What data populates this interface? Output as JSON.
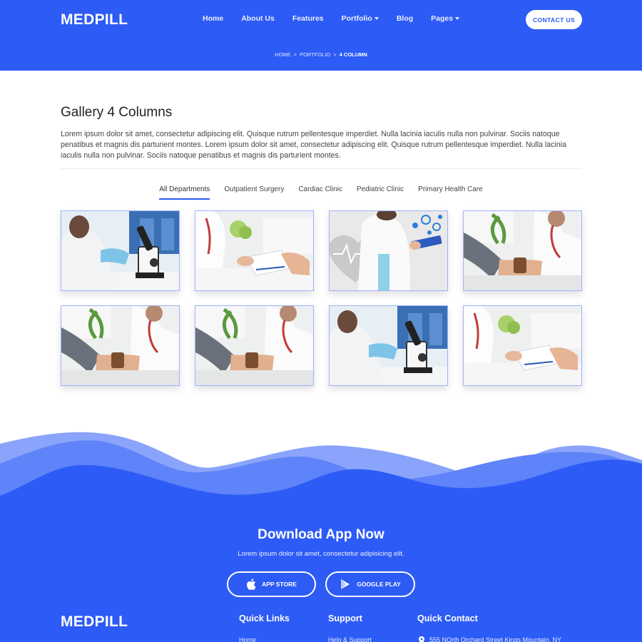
{
  "header": {
    "logo": "MEDPILL",
    "nav": [
      {
        "label": "Home"
      },
      {
        "label": "About Us"
      },
      {
        "label": "Features"
      },
      {
        "label": "Portfolio",
        "dropdown": true
      },
      {
        "label": "Blog"
      },
      {
        "label": "Pages",
        "dropdown": true
      }
    ],
    "contact_label": "CONTACT US",
    "breadcrumb": [
      "HOME",
      "PORTFOLIO",
      "4 COLUMN"
    ],
    "breadcrumb_separator": ">"
  },
  "main": {
    "title": "Gallery 4 Columns",
    "intro": "Lorem ipsum dolor sit amet, consectetur adipiscing elit. Quisque rutrum pellentesque imperdiet. Nulla lacinia iaculis nulla non pulvinar. Sociis natoque penatibus et magnis dis parturient montes. Lorem ipsum dolor sit amet, consectetur adipiscing elit. Quisque rutrum pellentesque imperdiet. Nulla lacinia iaculis nulla non pulvinar. Sociis natoque penatibus et magnis dis parturient montes.",
    "tabs": [
      {
        "label": "All Departments",
        "active": true
      },
      {
        "label": "Outpatient Surgery",
        "active": false
      },
      {
        "label": "Cardiac Clinic",
        "active": false
      },
      {
        "label": "Pediatric Clinic",
        "active": false
      },
      {
        "label": "Primary Health Care",
        "active": false
      }
    ],
    "gallery": [
      {
        "scene": "microscope"
      },
      {
        "scene": "consultation"
      },
      {
        "scene": "tablet"
      },
      {
        "scene": "blood-pressure"
      },
      {
        "scene": "blood-pressure"
      },
      {
        "scene": "blood-pressure"
      },
      {
        "scene": "microscope"
      },
      {
        "scene": "consultation"
      }
    ]
  },
  "footer": {
    "download_title": "Download App Now",
    "download_sub": "Lorem ipsum dolor sit amet, consectetur adipisicing elit.",
    "app_store": "APP STORE",
    "google_play": "GOOGLE PLAY",
    "logo": "MEDPILL",
    "quick_links_heading": "Quick Links",
    "quick_links_first": "Home",
    "support_heading": "Support",
    "support_first": "Help & Support",
    "contact_heading": "Quick Contact",
    "address": "555 NOrth Orchard Street Kings Mountain, NY"
  },
  "colors": {
    "primary": "#2d5bf5",
    "wave_light": "#8aa4fb",
    "wave_mid": "#5f83f8",
    "card_border": "#9fb2ff"
  }
}
